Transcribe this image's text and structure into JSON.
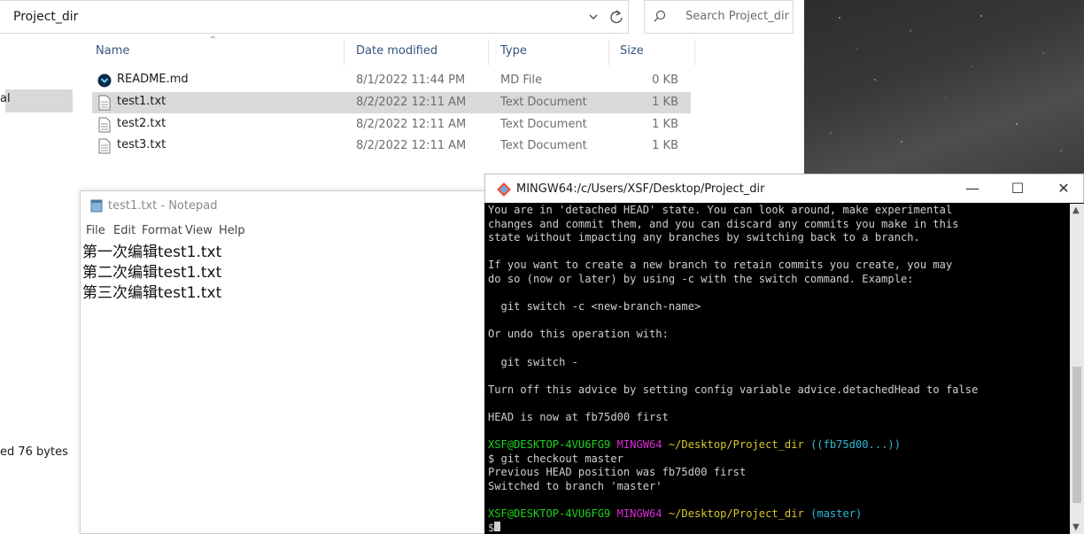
{
  "explorer": {
    "address_text": "Project_dir",
    "search_placeholder": "Search Project_dir",
    "nav_label_partial": "al",
    "status_partial": "ed 76 bytes",
    "columns": {
      "name": "Name",
      "date": "Date modified",
      "type": "Type",
      "size": "Size"
    },
    "files": [
      {
        "name": "README.md",
        "date": "8/1/2022 11:44 PM",
        "type": "MD File",
        "size": "0 KB",
        "icon": "markdown-file-icon"
      },
      {
        "name": "test1.txt",
        "date": "8/2/2022 12:11 AM",
        "type": "Text Document",
        "size": "1 KB",
        "icon": "text-file-icon"
      },
      {
        "name": "test2.txt",
        "date": "8/2/2022 12:11 AM",
        "type": "Text Document",
        "size": "1 KB",
        "icon": "text-file-icon"
      },
      {
        "name": "test3.txt",
        "date": "8/2/2022 12:11 AM",
        "type": "Text Document",
        "size": "1 KB",
        "icon": "text-file-icon"
      }
    ]
  },
  "notepad": {
    "title": "test1.txt - Notepad",
    "menu": [
      "File",
      "Edit",
      "Format",
      "View",
      "Help"
    ],
    "lines": [
      "第一次编辑test1.txt",
      "第二次编辑test1.txt",
      "第三次编辑test1.txt"
    ]
  },
  "gitbash": {
    "title": "MINGW64:/c/Users/XSF/Desktop/Project_dir",
    "controls": {
      "minimize": "—",
      "maximize": "☐",
      "close": "✕"
    },
    "colors": {
      "green": "#1bd41b",
      "magenta": "#d62bd6",
      "yellow": "#d6c72b",
      "cyan": "#2bb8d6",
      "text": "#cfcfcf"
    },
    "lines": [
      "You are in 'detached HEAD' state. You can look around, make experimental",
      "changes and commit them, and you can discard any commits you make in this",
      "state without impacting any branches by switching back to a branch.",
      "",
      "If you want to create a new branch to retain commits you create, you may",
      "do so (now or later) by using -c with the switch command. Example:",
      "",
      "  git switch -c <new-branch-name>",
      "",
      "Or undo this operation with:",
      "",
      "  git switch -",
      "",
      "Turn off this advice by setting config variable advice.detachedHead to false",
      "",
      "HEAD is now at fb75d00 first",
      ""
    ],
    "prompt1": {
      "user": "XSF@DESKTOP-4VU6FG9",
      "env": "MINGW64",
      "path": "~/Desktop/Project_dir",
      "branch": "((fb75d00...))"
    },
    "command": "$ git checkout master",
    "output": [
      "Previous HEAD position was fb75d00 first",
      "Switched to branch 'master'",
      ""
    ],
    "prompt2": {
      "user": "XSF@DESKTOP-4VU6FG9",
      "env": "MINGW64",
      "path": "~/Desktop/Project_dir",
      "branch": "(master)"
    },
    "final_prompt": "$"
  }
}
